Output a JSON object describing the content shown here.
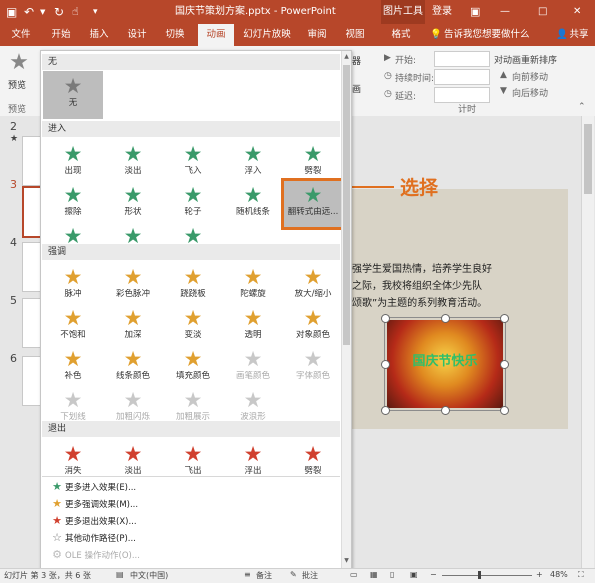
{
  "window": {
    "title": "国庆节策划方案.pptx - PowerPoint",
    "context_tab_group": "图片工具",
    "login": "登录",
    "minimize": "—",
    "maximize": "□",
    "close": "✕"
  },
  "tabs": [
    "文件",
    "开始",
    "插入",
    "设计",
    "切换",
    "动画",
    "幻灯片放映",
    "审阅",
    "视图",
    "格式"
  ],
  "active_tab": "动画",
  "tell_me": "告诉我您想要做什么",
  "share": "共享",
  "ribbon": {
    "preview_label": "预览",
    "preview_group": "预览",
    "start_label": "开始:",
    "duration_label": "持续时间:",
    "delay_label": "延迟:",
    "reorder_title": "对动画重新排序",
    "move_earlier": "向前移动",
    "move_later": "向后移动",
    "timing_group": "计时",
    "trigger_label": "器",
    "painter_label": "画"
  },
  "gallery": {
    "none_section": "无",
    "none_item": "无",
    "entrance_section": "进入",
    "entrance": [
      "出现",
      "淡出",
      "飞入",
      "浮入",
      "劈裂",
      "擦除",
      "形状",
      "轮子",
      "随机线条",
      "翻转式由远...",
      "缩放",
      "旋转",
      "弹跳"
    ],
    "emphasis_section": "强调",
    "emphasis": [
      "脉冲",
      "彩色脉冲",
      "跷跷板",
      "陀螺旋",
      "放大/缩小",
      "不饱和",
      "加深",
      "变淡",
      "透明",
      "对象颜色",
      "补色",
      "线条颜色",
      "填充颜色",
      "画笔颜色",
      "字体颜色",
      "下划线",
      "加粗闪烁",
      "加粗展示",
      "波浪形"
    ],
    "exit_section": "退出",
    "exit": [
      "消失",
      "淡出",
      "飞出",
      "浮出",
      "劈裂"
    ],
    "menu": [
      "更多进入效果(E)...",
      "更多强调效果(M)...",
      "更多退出效果(X)...",
      "其他动作路径(P)...",
      "OLE 操作动作(O)..."
    ]
  },
  "callout": "选择",
  "slides_panel": {
    "numbers": [
      "2",
      "3",
      "4",
      "5",
      "6"
    ],
    "active": "3"
  },
  "slide": {
    "text_line1": "强学生爱国热情，培养学生良好",
    "text_line2": "之际，我校将组织全体少先队",
    "text_line3": "颂歌”为主题的系列教育活动。",
    "image_caption": "国庆节快乐"
  },
  "status": {
    "slide_info": "幻灯片 第 3 张，共 6 张",
    "language": "中文(中国)",
    "notes": "备注",
    "comments": "批注",
    "zoom": "48%"
  },
  "colors": {
    "brand": "#b7472a",
    "entrance_star": "#3a9a6a",
    "emphasis_star": "#e0a030",
    "exit_star": "#d0402e",
    "callout": "#e07020"
  }
}
